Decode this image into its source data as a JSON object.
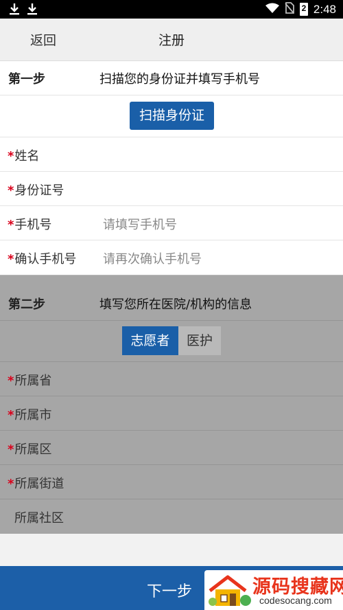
{
  "status": {
    "time": "2:48",
    "battery": "2"
  },
  "header": {
    "back": "返回",
    "title": "注册"
  },
  "step1": {
    "label": "第一步",
    "desc": "扫描您的身份证并填写手机号",
    "scan_button": "扫描身份证",
    "fields": [
      {
        "label": "姓名",
        "required": "*",
        "placeholder": ""
      },
      {
        "label": "身份证号",
        "required": "*",
        "placeholder": ""
      },
      {
        "label": "手机号",
        "required": "*",
        "placeholder": "请填写手机号"
      },
      {
        "label": "确认手机号",
        "required": "*",
        "placeholder": "请再次确认手机号"
      }
    ]
  },
  "step2": {
    "label": "第二步",
    "desc": "填写您所在医院/机构的信息",
    "toggle": {
      "selected": "志愿者",
      "other": "医护"
    },
    "fields": [
      {
        "label": "所属省",
        "required": "*"
      },
      {
        "label": "所属市",
        "required": "*"
      },
      {
        "label": "所属区",
        "required": "*"
      },
      {
        "label": "所属街道",
        "required": "*"
      },
      {
        "label": "所属社区",
        "required": ""
      }
    ]
  },
  "footer": {
    "next": "下一步"
  },
  "watermark": {
    "title": "源码搜藏网",
    "url": "codesocang.com"
  },
  "colors": {
    "primary": "#1a5fa8",
    "required": "#d9001b",
    "section2_bg": "#a6a6a6"
  }
}
